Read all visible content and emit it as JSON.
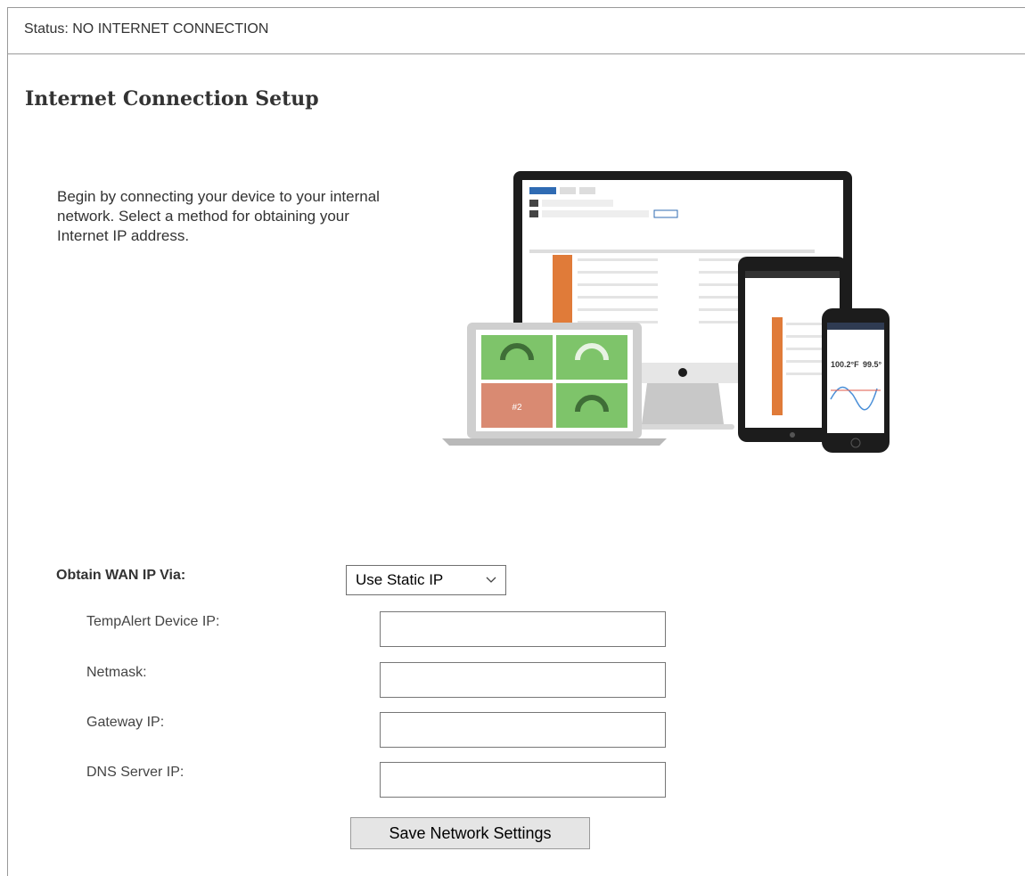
{
  "status": {
    "text": "Status: NO INTERNET CONNECTION"
  },
  "page": {
    "title": "Internet Connection Setup",
    "intro": "Begin by connecting your device to your internal network. Select a method for obtaining your Internet IP address."
  },
  "illustration": {
    "name": "multi-device-dashboard-mockup",
    "readings": [
      "100.2°F",
      "99.5°"
    ],
    "tile_label": "#2"
  },
  "form": {
    "wan_label": "Obtain WAN IP Via:",
    "wan_select_value": "Use Static IP",
    "fields": [
      {
        "label": "TempAlert Device IP:",
        "value": ""
      },
      {
        "label": "Netmask:",
        "value": ""
      },
      {
        "label": "Gateway IP:",
        "value": ""
      },
      {
        "label": "DNS Server IP:",
        "value": ""
      }
    ],
    "save_label": "Save Network Settings"
  },
  "colors": {
    "border": "#999999",
    "button_bg": "#e5e5e5",
    "tile_green": "#7ec46a",
    "tile_red": "#d98a72",
    "sidebar_orange": "#e07b39"
  }
}
